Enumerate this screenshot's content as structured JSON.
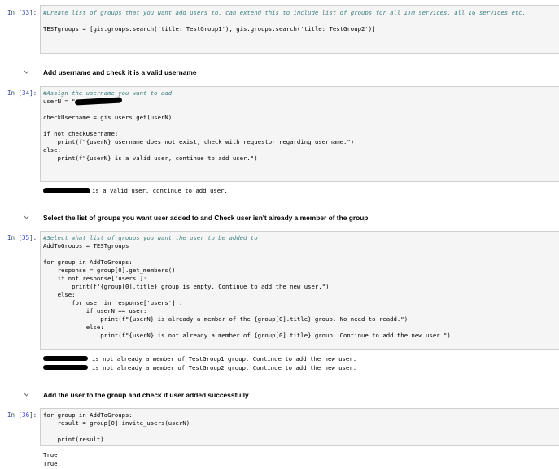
{
  "cells": {
    "c33": {
      "prompt": "In [33]:",
      "line1": "#Create list of groups that you want add users to, can extend this to include list of groups for all ITM services, all IG services etc.",
      "line2": "TESTgroups = [gis.groups.search('title: TestGroup1'), gis.groups.search('title: TestGroup2')]"
    },
    "md1": "Add username and check it is a valid username",
    "c34": {
      "prompt": "In [34]:",
      "line1": "#Assign the username you want to add",
      "line2a": "userN = \"",
      "line3": "checkUsername = gis.users.get(userN)",
      "line4": "if not checkUsername:",
      "line5": "    print(f\"{userN} username does not exist, check with requestor regarding username.\")",
      "line6": "else:",
      "line7": "    print(f\"{userN} is a valid user, continue to add user.\")",
      "output": "is a valid user, continue to add user."
    },
    "md2": "Select the list of groups you want user added to and Check user isn't already a member of the group",
    "c35": {
      "prompt": "In [35]:",
      "line1": "#Select what list of groups you want the user to be added to",
      "line2": "AddToGroups = TESTgroups",
      "line3": "for group in AddToGroups:",
      "line4": "    response = group[0].get_members()",
      "line5": "    if not response['users']:",
      "line6": "        print(f\"{group[0].title} group is empty. Continue to add the new user.\")",
      "line7": "    else:",
      "line8": "        for user in response['users'] :",
      "line9": "            if userN == user:",
      "line10": "                print(f\"{userN} is already a member of the {group[0].title} group. No need to readd.\")",
      "line11": "            else:",
      "line12": "                print(f\"{userN} is not already a member of {group[0].title} group. Continue to add the new user.\")",
      "output1": "is not already a member of TestGroup1 group. Continue to add the new user.",
      "output2": "is not already a member of TestGroup2 group. Continue to add the new user."
    },
    "md3": "Add the user to the group and check if user added successfully",
    "c36": {
      "prompt": "In [36]:",
      "line1": "for group in AddToGroups:",
      "line2": "    result = group[0].invite_users(userN)",
      "line3": "    print(result)",
      "output1": "True",
      "output2": "True"
    }
  }
}
